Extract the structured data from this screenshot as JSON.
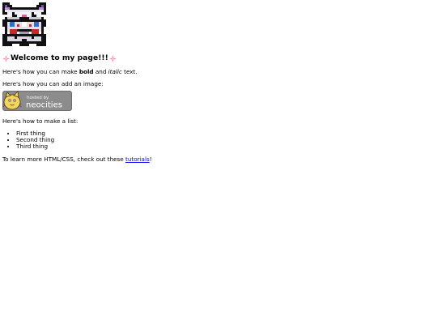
{
  "avatar": {
    "icon": "pixel-cat-icon"
  },
  "heading": {
    "icon": "sparkle-icon",
    "text": "Welcome to my page!!!"
  },
  "paragraph_formatting": {
    "before": "Here's how you can make ",
    "bold": "bold",
    "middle": " and ",
    "italic": "italic",
    "after": " text."
  },
  "paragraph_image": "Here's how you can add an image:",
  "badge": {
    "line1": "hosted by",
    "line2": "neocities",
    "icon": "neocities-cat-icon"
  },
  "paragraph_list": "Here's how to make a list:",
  "list_items": [
    "First thing",
    "Second thing",
    "Third thing"
  ],
  "paragraph_tutorials": {
    "before": "To learn more HTML/CSS, check out these ",
    "link": "tutorials",
    "after": "!"
  },
  "colors": {
    "link": "#0000ee",
    "badge_bg": "#8c8c8c",
    "sparkle": "#ff7a9c"
  }
}
